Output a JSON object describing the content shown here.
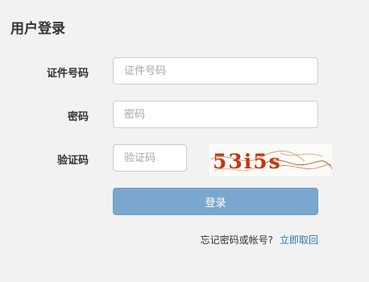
{
  "page": {
    "title": "用户登录"
  },
  "form": {
    "id_label": "证件号码",
    "id_placeholder": "证件号码",
    "id_value": "",
    "password_label": "密码",
    "password_placeholder": "密码",
    "password_value": "",
    "captcha_label": "验证码",
    "captcha_placeholder": "验证码",
    "captcha_value": "",
    "captcha_image_text": "53i5s",
    "login_label": "登录"
  },
  "recovery": {
    "prompt": "忘记密码或帐号?",
    "link": "立即取回"
  },
  "colors": {
    "background": "#f2f2f2",
    "button": "#7aa7cd",
    "link": "#2f77b5",
    "captcha_text": "#c03810"
  }
}
